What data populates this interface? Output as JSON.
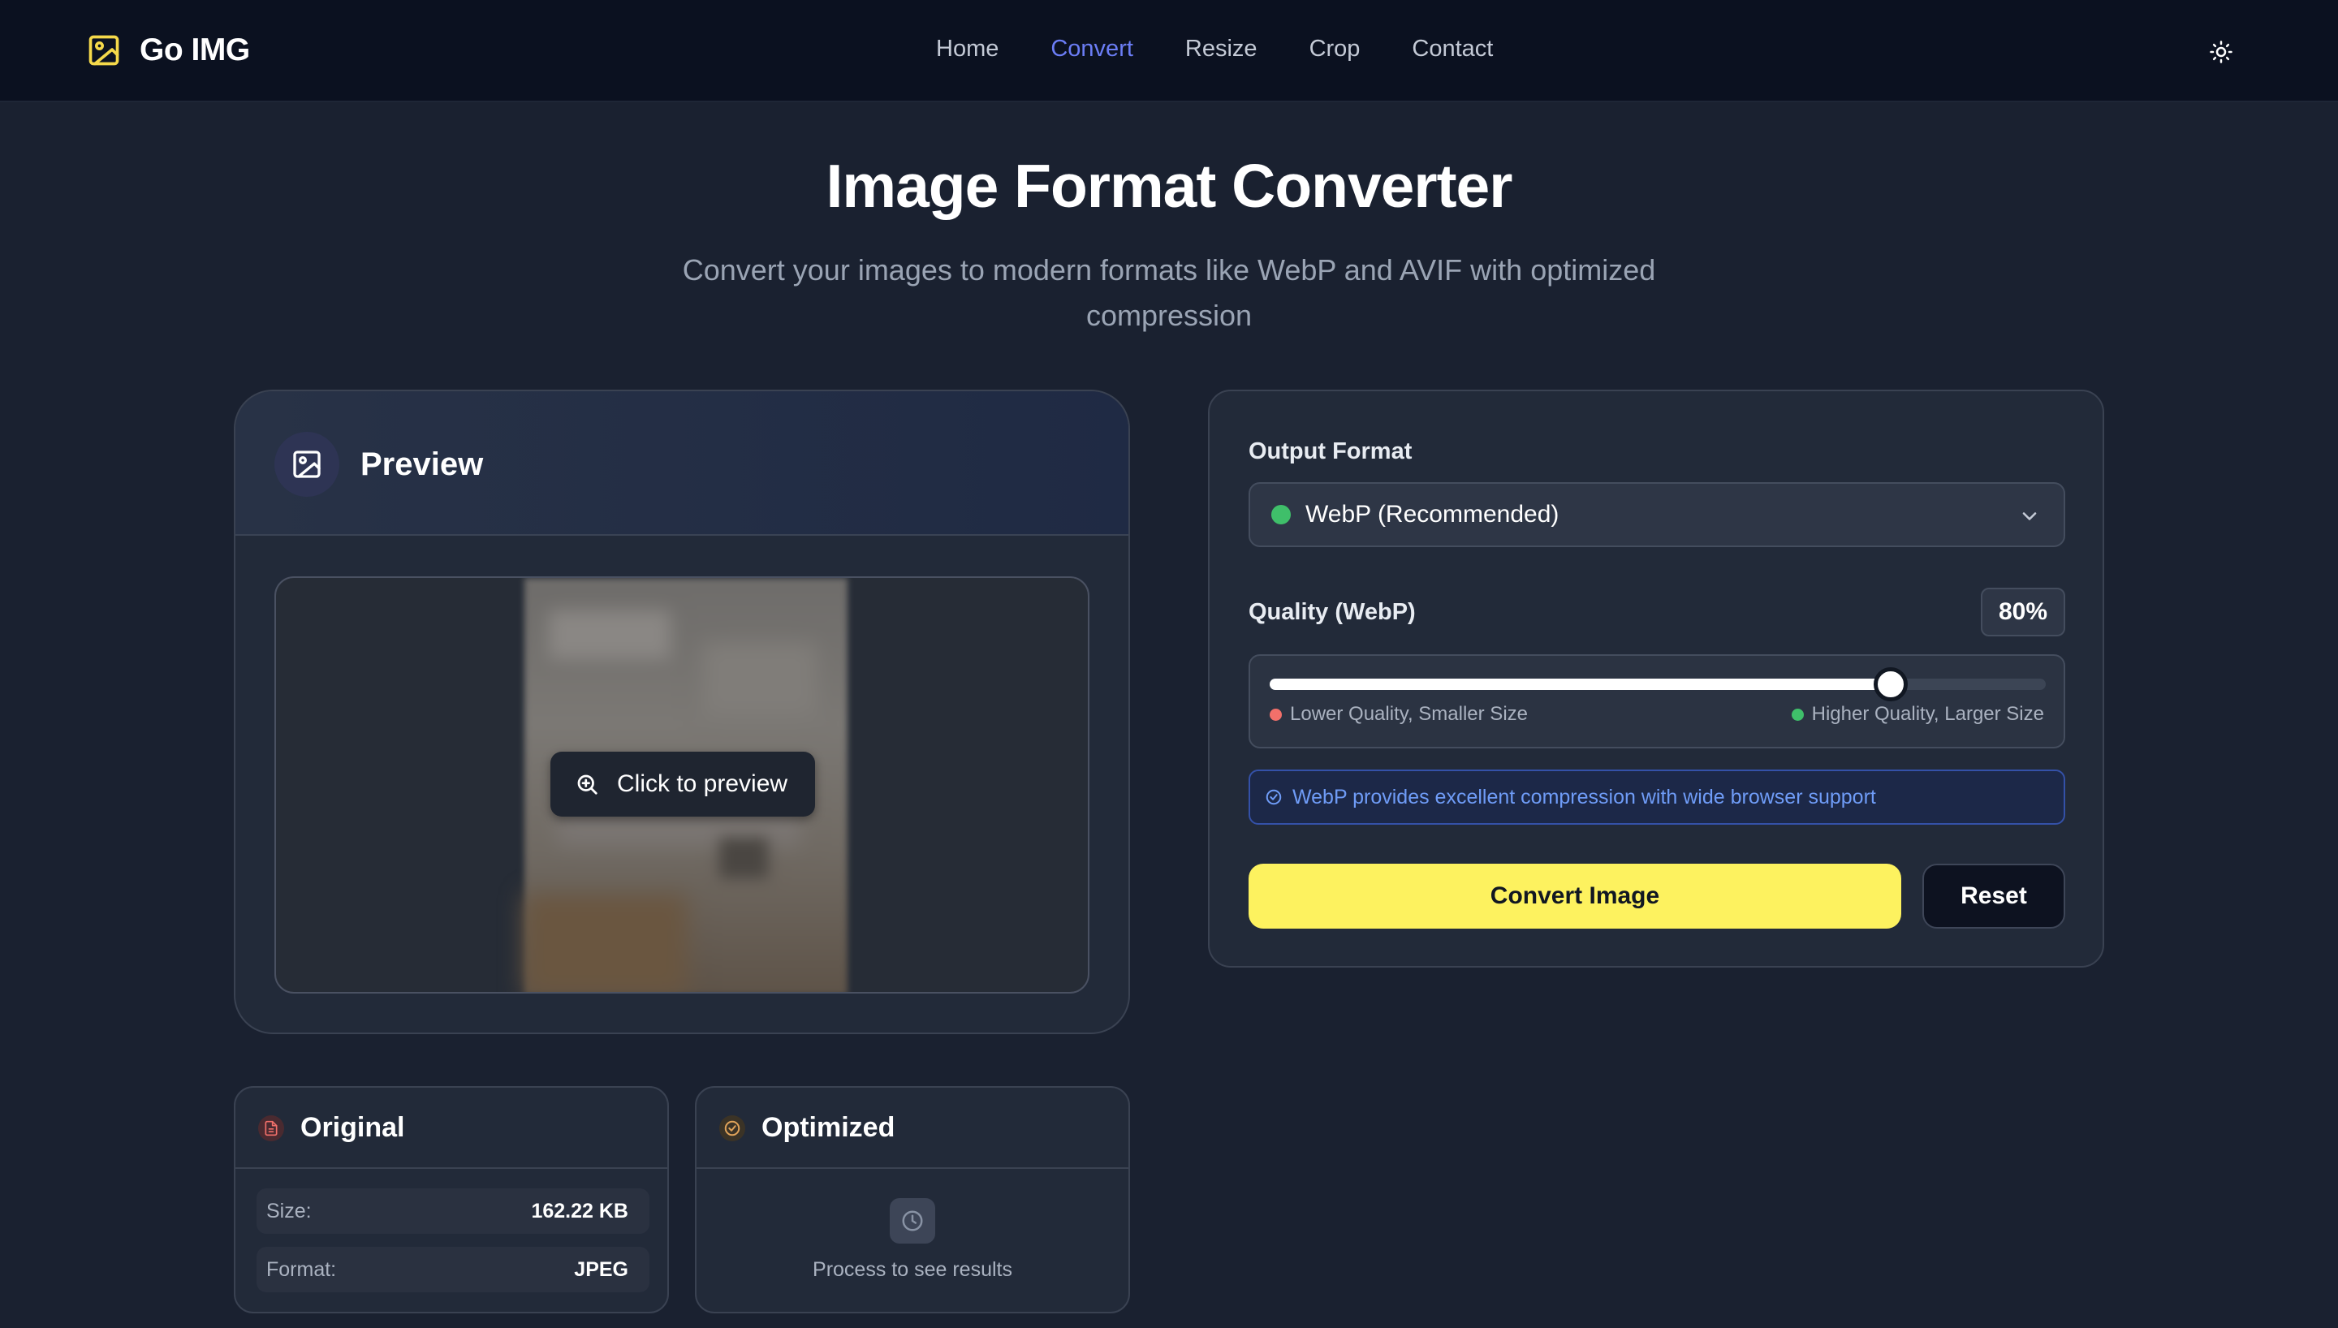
{
  "header": {
    "brand": "Go IMG",
    "nav": [
      {
        "label": "Home",
        "active": false
      },
      {
        "label": "Convert",
        "active": true
      },
      {
        "label": "Resize",
        "active": false
      },
      {
        "label": "Crop",
        "active": false
      },
      {
        "label": "Contact",
        "active": false
      }
    ],
    "theme_toggle_icon": "sun-icon"
  },
  "hero": {
    "title": "Image Format Converter",
    "subtitle_line1": "Convert your images to modern formats like WebP and AVIF with optimized",
    "subtitle_line2": "compression"
  },
  "preview": {
    "title": "Preview",
    "icon": "image-icon",
    "button_label": "Click to preview",
    "button_icon": "zoom-in-icon"
  },
  "original": {
    "title": "Original",
    "icon": "file-icon",
    "rows": [
      {
        "key": "Size:",
        "value": "162.22 KB"
      },
      {
        "key": "Format:",
        "value": "JPEG"
      }
    ]
  },
  "optimized": {
    "title": "Optimized",
    "icon": "check-circle-icon",
    "pending_icon": "clock-icon",
    "pending_text": "Process to see results"
  },
  "settings": {
    "output_format_label": "Output Format",
    "selected_format": "WebP (Recommended)",
    "quality_label": "Quality (WebP)",
    "quality_value": "80%",
    "quality_fraction": 0.8,
    "low_hint": "Lower Quality, Smaller Size",
    "high_hint": "Higher Quality, Larger Size",
    "info_text": "WebP provides excellent compression with wide browser support",
    "convert_label": "Convert Image",
    "reset_label": "Reset"
  },
  "colors": {
    "accent": "#6b7df5",
    "primary_button": "#fdf25f",
    "format_dot": "#3fbf6a",
    "low_dot": "#f2706a",
    "high_dot": "#3fbf6a",
    "info": "#6f9cf7"
  }
}
